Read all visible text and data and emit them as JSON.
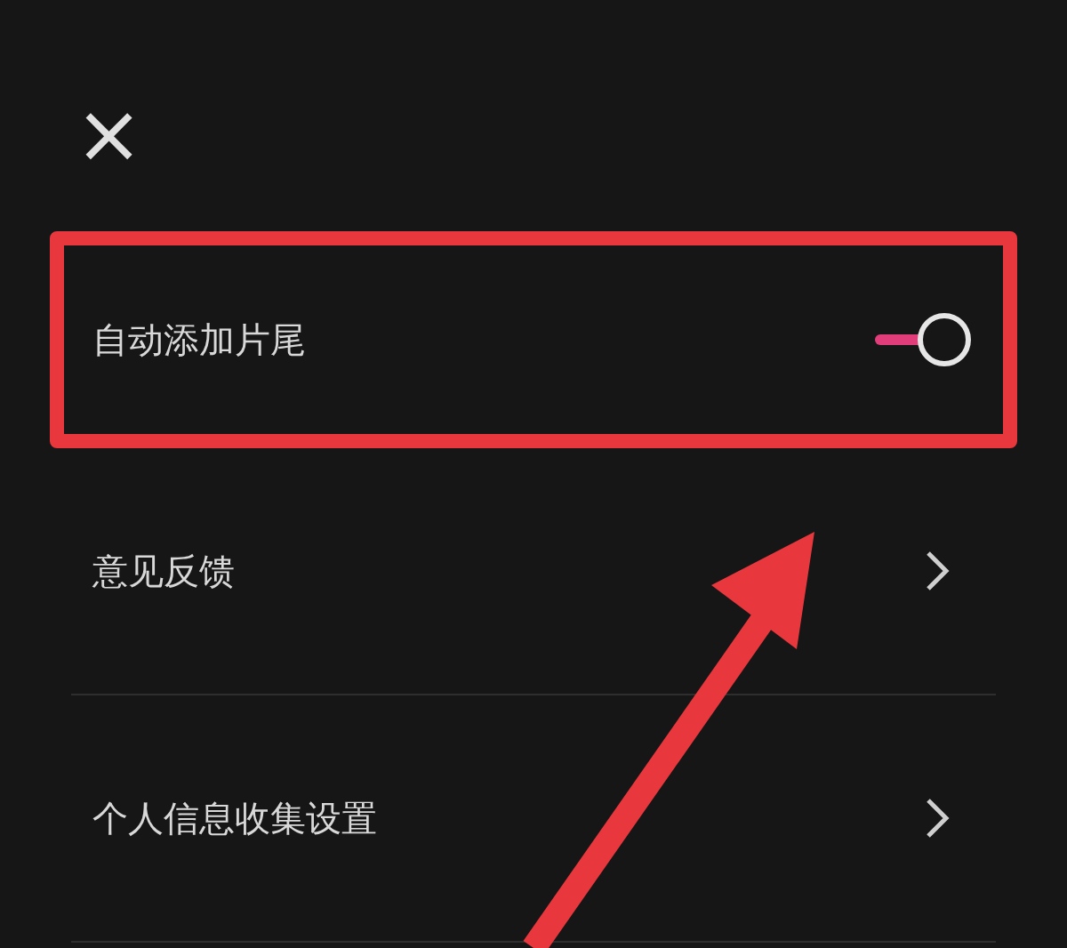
{
  "close_button": {
    "label": "×"
  },
  "settings": [
    {
      "kind": "toggle",
      "label": "自动添加片尾",
      "on": true,
      "highlighted": true
    },
    {
      "kind": "link",
      "label": "意见反馈",
      "highlighted": false
    },
    {
      "kind": "link",
      "label": "个人信息收集设置",
      "highlighted": false
    }
  ]
}
